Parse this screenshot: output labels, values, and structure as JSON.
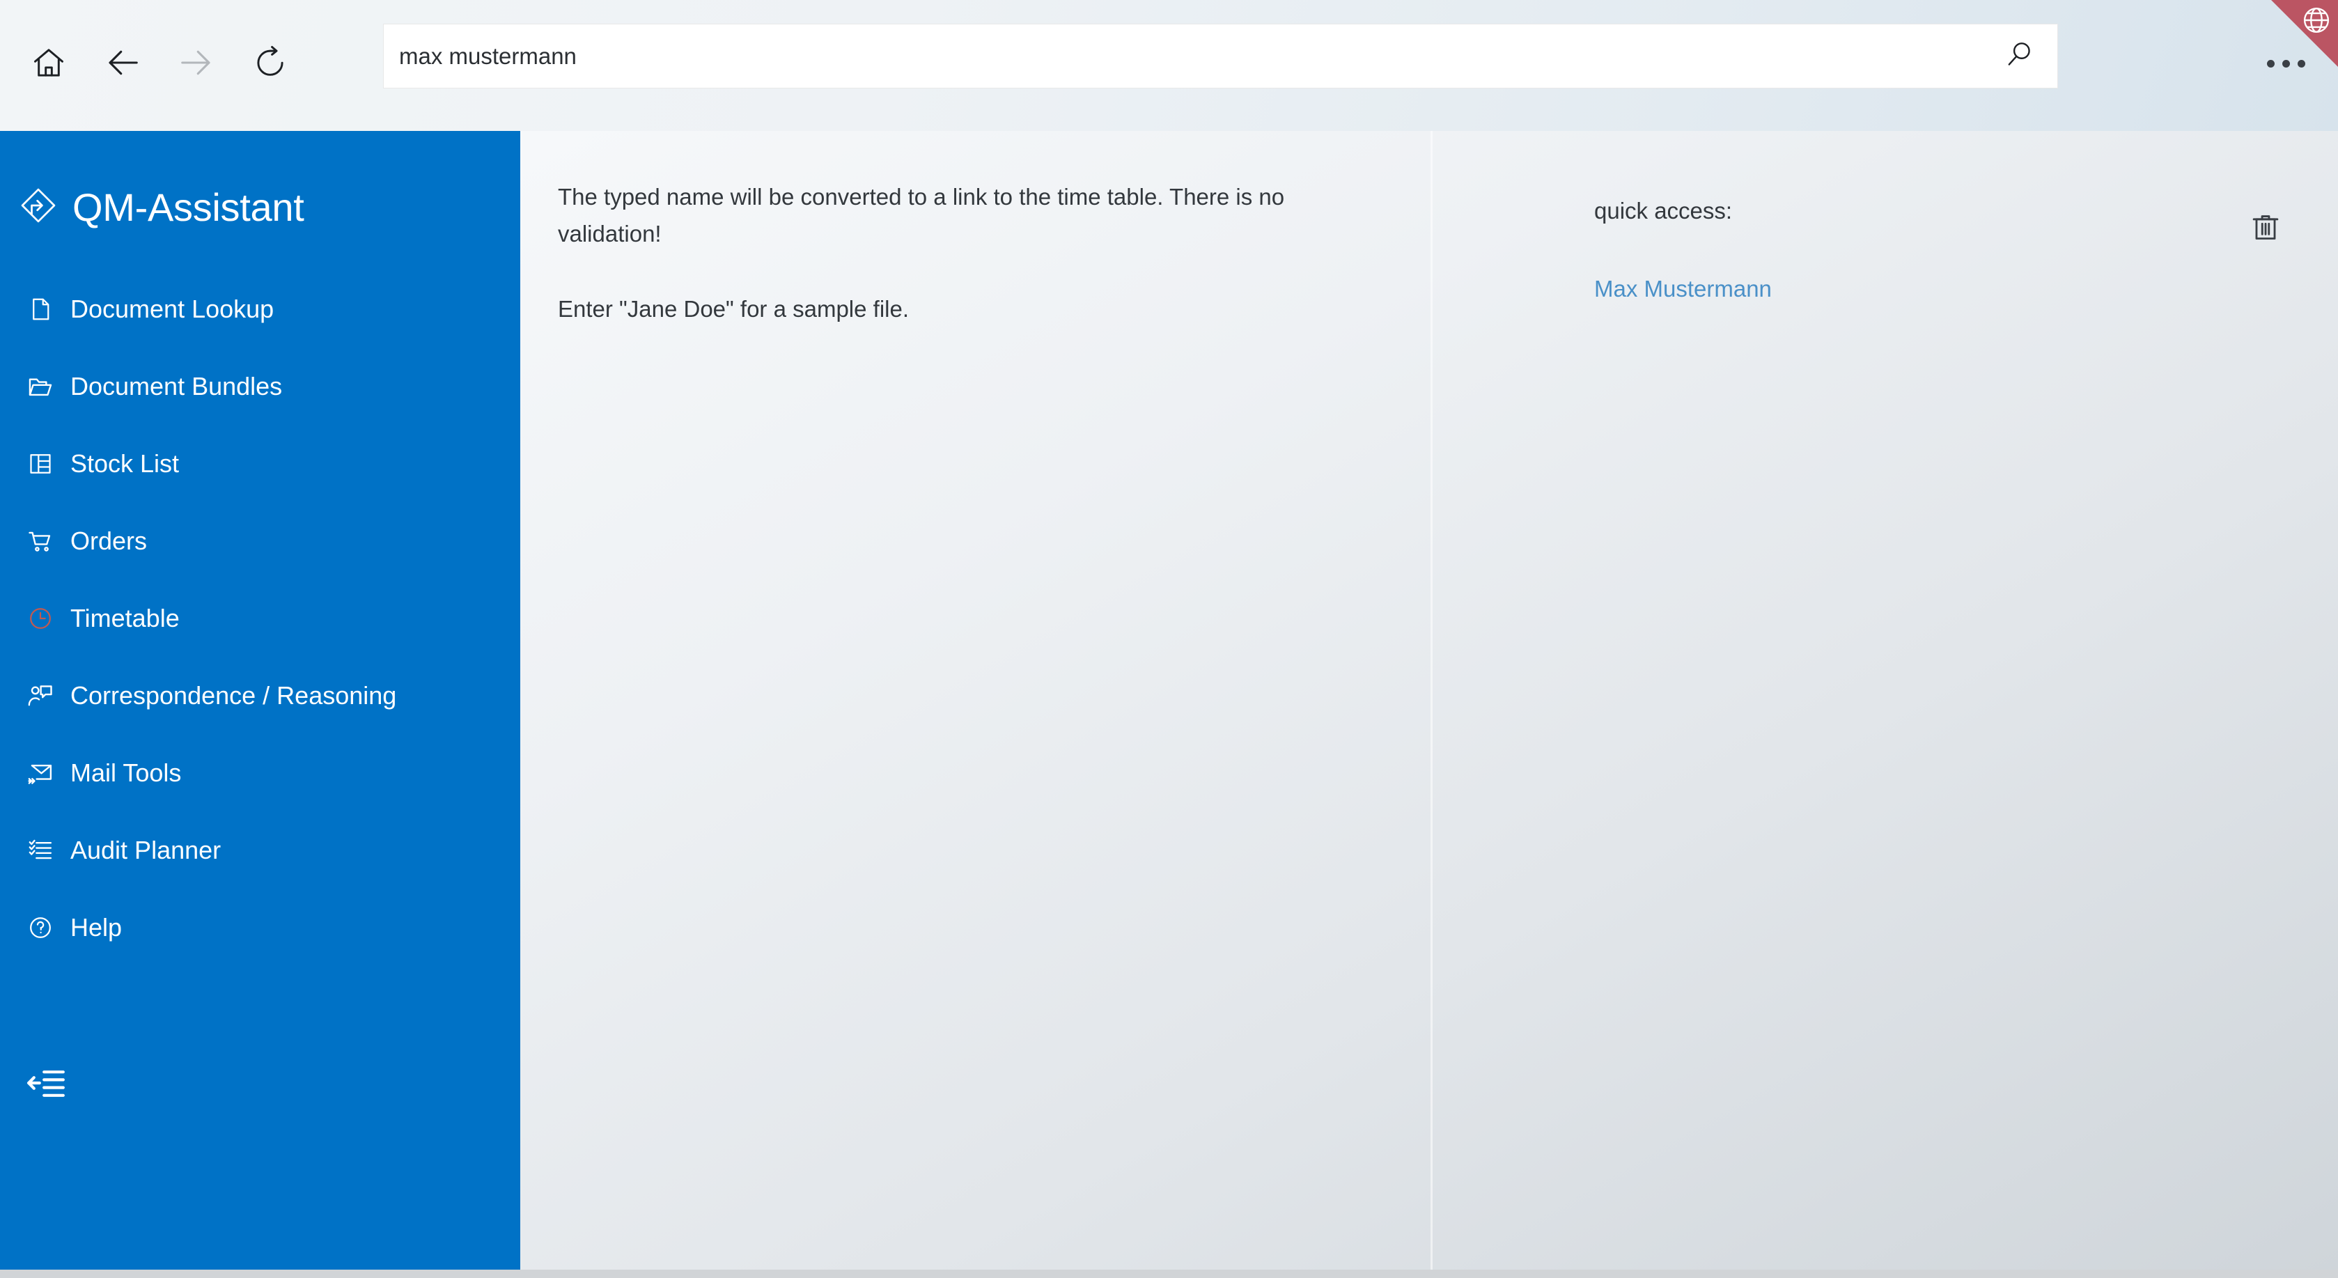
{
  "toolbar": {
    "home_label": "Home",
    "back_label": "Back",
    "forward_label": "Forward",
    "reload_label": "Reload",
    "more_label": "More options",
    "status_badge": "online-globe"
  },
  "search": {
    "value": "max mustermann",
    "placeholder": "Search",
    "icon": "search-icon",
    "button_label": "Search"
  },
  "sidebar": {
    "brand": "QM-Assistant",
    "brand_icon": "diamond-arrow-logo",
    "collapse_label": "Collapse navigation",
    "collapse_icon": "collapse-left-icon",
    "items": [
      {
        "label": "Document Lookup",
        "icon": "document-icon",
        "accent": "#ffffff"
      },
      {
        "label": "Document Bundles",
        "icon": "folder-open-icon",
        "accent": "#ffffff"
      },
      {
        "label": "Stock List",
        "icon": "grid-table-icon",
        "accent": "#ffffff"
      },
      {
        "label": "Orders",
        "icon": "shopping-cart-icon",
        "accent": "#ffffff"
      },
      {
        "label": "Timetable",
        "icon": "clock-icon",
        "accent": "#c05a52"
      },
      {
        "label": "Correspondence / Reasoning",
        "icon": "person-message-icon",
        "accent": "#ffffff"
      },
      {
        "label": "Mail Tools",
        "icon": "mail-forward-icon",
        "accent": "#ffffff"
      },
      {
        "label": "Audit Planner",
        "icon": "checklist-icon",
        "accent": "#ffffff"
      },
      {
        "label": "Help",
        "icon": "question-circle-icon",
        "accent": "#ffffff"
      }
    ]
  },
  "main": {
    "paragraphs": [
      "The typed name will be converted to a link to the time table. There is no validation!",
      "Enter \"Jane Doe\" for a sample file."
    ]
  },
  "quick_access": {
    "heading": "quick access:",
    "clear_label": "Clear quick access",
    "clear_icon": "trash-icon",
    "links": [
      {
        "label": "Max Mustermann"
      }
    ]
  },
  "colors": {
    "sidebar_blue": "#0072c6",
    "link_blue": "#4a90c8",
    "timetable_red": "#c05a52",
    "ribbon_red": "#bb5563",
    "text_dark": "#33383d"
  }
}
